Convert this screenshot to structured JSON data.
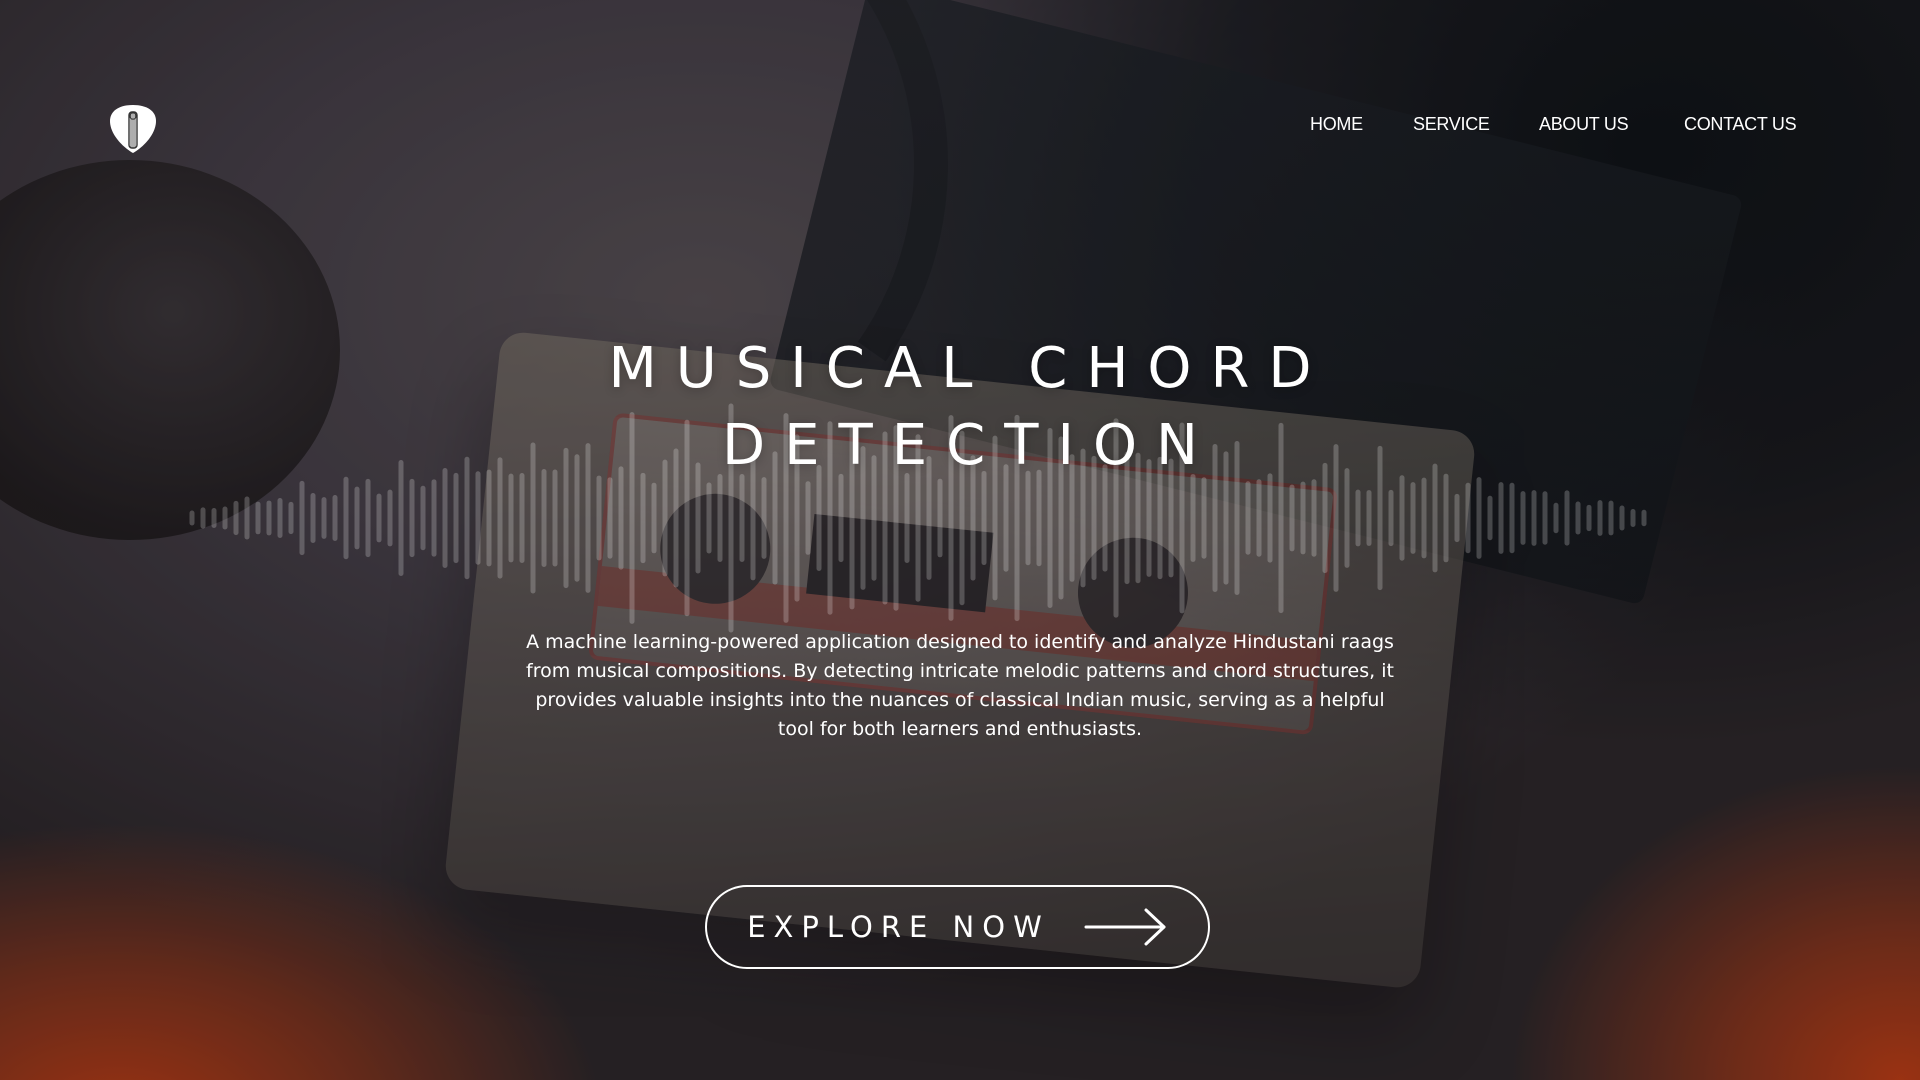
{
  "nav": {
    "home": "HOME",
    "service": "SERVICE",
    "about": "ABOUT US",
    "contact": "CONTACT US"
  },
  "logo": {
    "icon": "guitar-pick-icon"
  },
  "hero": {
    "title_line1": "MUSICAL CHORD",
    "title_line2": "DETECTION",
    "description": "A machine learning-powered application designed to identify and analyze Hindustani raags from musical compositions. By detecting intricate melodic patterns and chord structures, it provides valuable insights into the nuances of classical Indian music, serving as a helpful tool for both learners and enthusiasts.",
    "cta_label": "EXPLORE NOW",
    "cta_icon": "arrow-right-icon"
  },
  "colors": {
    "accent": "#d64010",
    "text": "#ffffff"
  }
}
